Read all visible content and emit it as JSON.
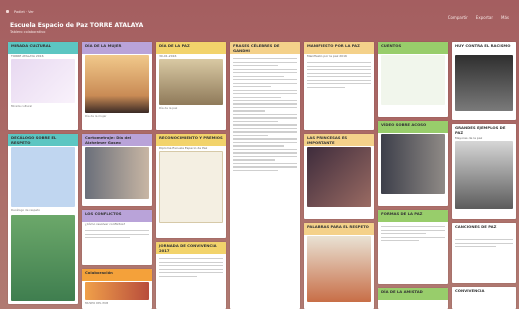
{
  "header": {
    "breadcrumb": "Padlet · Ver",
    "title": "Escuela Espacio de Paz TORRE ATALAYA",
    "subtitle": "Tablero colaborativo",
    "actions": [
      "Compartir",
      "Exportar",
      "Más"
    ]
  },
  "columns": [
    {
      "cards": [
        {
          "title": "MIRADA CULTURAL",
          "subtitle": "TORRE ATALAYA 2016",
          "footer": "Mirada cultural",
          "color": "#5cc6c2"
        },
        {
          "title": "DECÁLOGO SOBRE EL RESPETO",
          "footer": "Decálogo de respeto",
          "color": "#5cc6c2"
        }
      ]
    },
    {
      "cards": [
        {
          "title": "DÍA DE LA MUJER",
          "footer": "Día de la mujer",
          "color": "#b9a3d9"
        },
        {
          "title": "Cortometraje: Día del Alzheimer Gaseo",
          "color": "#b9a3d9"
        },
        {
          "title": "LOS CONFLICTOS",
          "subtitle": "¿Cómo resolver conflictos?",
          "color": "#b9a3d9"
        },
        {
          "title": "Colaboración",
          "footer": "MUSEO DEL PUB",
          "color": "#f4a13a"
        }
      ]
    },
    {
      "cards": [
        {
          "title": "DÍA DE LA PAZ",
          "subtitle": "30-01-2016",
          "footer": "Día de la paz",
          "color": "#f2d36b"
        },
        {
          "title": "RECONOCIMIENTO Y PREMIOS",
          "subtitle": "Diploma Escuela Espacio de Paz",
          "color": "#f2d36b"
        },
        {
          "title": "JORNADA DE CONVIVENCIA 2017",
          "color": "#f2d36b"
        }
      ]
    },
    {
      "cards": [
        {
          "title": "FRASES CÉLEBRES DE GANDHI",
          "color": "#f4d18a"
        }
      ]
    },
    {
      "cards": [
        {
          "title": "MANIFIESTO POR LA PAZ",
          "subtitle": "Manifiesto por la paz 2016",
          "color": "#f4d18a"
        },
        {
          "title": "LAS PRINCESAS ES IMPORTANTE",
          "color": "#f4d18a"
        },
        {
          "title": "PALABRAS PARA EL RESPETO",
          "color": "#f4d18a"
        }
      ]
    },
    {
      "cards": [
        {
          "title": "CUENTOS",
          "color": "#98cd6b"
        },
        {
          "title": "VÍDEO SOBRE ACOSO",
          "color": "#98cd6b"
        },
        {
          "title": "FORMAS DE LA PAZ",
          "color": "#98cd6b"
        },
        {
          "title": "DÍA DE LA AMISTAD",
          "color": "#98cd6b"
        }
      ]
    },
    {
      "cards": [
        {
          "title": "HUY CONTRA EL RACISMO",
          "color": "#ffffff"
        },
        {
          "title": "GRANDES EJEMPLOS DE PAZ",
          "subtitle": "Mayores de la paz",
          "color": "#ffffff"
        },
        {
          "title": "CANCIONES DE PAZ",
          "color": "#ffffff"
        },
        {
          "title": "CONVIVENCIA",
          "color": "#ffffff"
        }
      ]
    }
  ]
}
